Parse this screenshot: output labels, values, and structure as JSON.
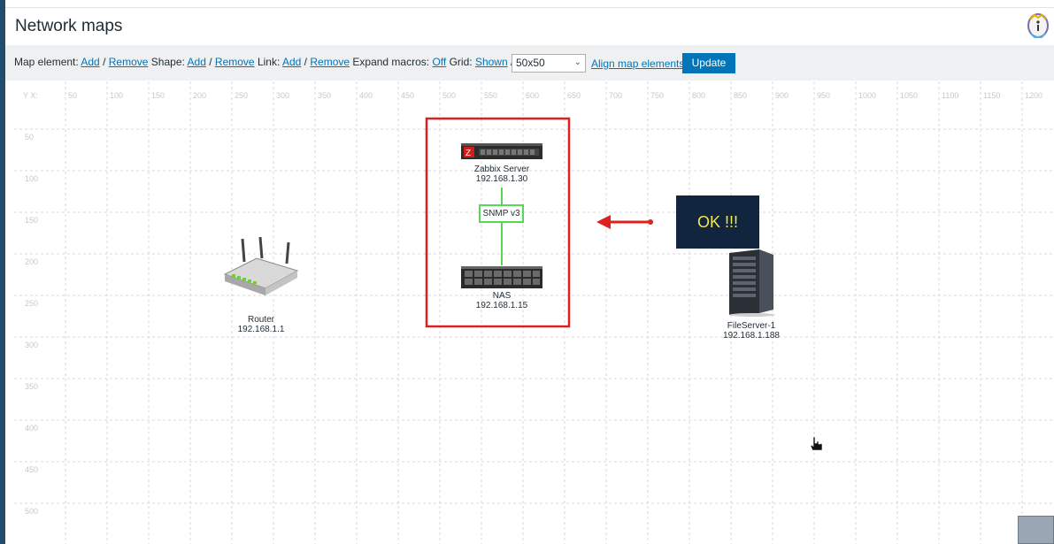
{
  "header": {
    "title": "Network maps"
  },
  "toolbar": {
    "map_element_label": "Map element:",
    "map_element_add": "Add",
    "map_element_remove": "Remove",
    "shape_label": "Shape:",
    "shape_add": "Add",
    "shape_remove": "Remove",
    "link_label": "Link:",
    "link_add": "Add",
    "link_remove": "Remove",
    "expand_macros_label": "Expand macros:",
    "expand_macros_value": "Off",
    "grid_label": "Grid:",
    "grid_shown": "Shown",
    "grid_on": "On",
    "grid_size": "50x50",
    "align_label": "Align map elements",
    "update_label": "Update",
    "separator": "/"
  },
  "map": {
    "axis_corner": "Y X:",
    "x_ticks": [
      "50",
      "100",
      "150",
      "200",
      "250",
      "300",
      "350",
      "400",
      "450",
      "500",
      "550",
      "600",
      "650",
      "700",
      "750",
      "800",
      "850",
      "900",
      "950",
      "1000",
      "1050",
      "1100",
      "1150",
      "1200"
    ],
    "y_ticks": [
      "50",
      "100",
      "150",
      "200",
      "250",
      "300",
      "350",
      "400",
      "450",
      "500"
    ],
    "elements": {
      "zabbix_name": "Zabbix Server",
      "zabbix_ip": "192.168.1.30",
      "link_label": "SNMP v3",
      "nas_name": "NAS",
      "nas_ip": "192.168.1.15",
      "router_name": "Router",
      "router_ip": "192.168.1.1",
      "fileserver_name": "FileServer-1",
      "fileserver_ip": "192.168.1.188"
    },
    "annotation": "OK !!!",
    "colors": {
      "highlight": "#e02020",
      "link": "#55d855",
      "annotation_bg": "#11253f",
      "annotation_text": "#f3e94a",
      "accent": "#0275b8"
    }
  }
}
